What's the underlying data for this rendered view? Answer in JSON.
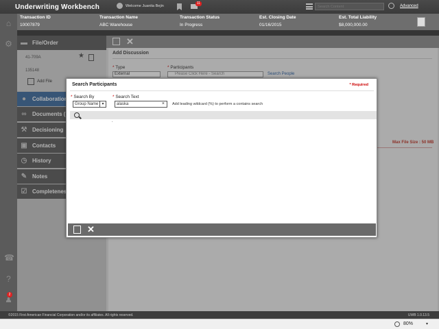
{
  "app": {
    "title": "Underwriting Workbench",
    "welcome": "Welcome Juanita Bejin",
    "mail_count": "11",
    "search_placeholder": "Search Content",
    "advanced_label": "Advanced",
    "notification_count": "2"
  },
  "transaction": {
    "columns": [
      {
        "header": "Transaction ID",
        "value": "10007879"
      },
      {
        "header": "Transaction Name",
        "value": "ABC Warehouse"
      },
      {
        "header": "Transaction Status",
        "value": "In Progress"
      },
      {
        "header": "Est. Closing Date",
        "value": "01/16/2015"
      },
      {
        "header": "Est. Total Liability",
        "value": "$8,000,000.00"
      }
    ]
  },
  "sidebar": {
    "file_order_label": "File/Order",
    "files": [
      "41-709A",
      "135148"
    ],
    "add_file_label": "Add File",
    "items": [
      {
        "label": "Collaboration",
        "icon": "collaboration-icon"
      },
      {
        "label": "Documents (",
        "icon": "link-icon"
      },
      {
        "label": "Decisioning",
        "icon": "gavel-icon"
      },
      {
        "label": "Contacts",
        "icon": "contacts-icon"
      },
      {
        "label": "History",
        "icon": "clock-icon"
      },
      {
        "label": "Notes",
        "icon": "notes-icon"
      },
      {
        "label": "Completeness",
        "icon": "checklist-icon"
      }
    ]
  },
  "main": {
    "section_title": "Add Discussion",
    "type_label": "Type",
    "type_value": "External",
    "participants_label": "Participants",
    "participants_placeholder": "Please Click Here - Search",
    "search_people_label": "Search People",
    "max_file_size": "Max File Size : 50 MB"
  },
  "modal": {
    "title": "Search Participants",
    "required_label": "* Required",
    "search_by_label": "Search By",
    "search_by_value": "Group Name",
    "search_text_label": "Search Text",
    "search_text_value": "alaska",
    "hint": "Add leading wildcard (%) to perform a contains search",
    "result_text": "."
  },
  "footer": {
    "copyright": "©2015 First American Financial Corporation and/or its affiliates. All rights reserved.",
    "version": "UWB 1.0.13.5"
  },
  "statusbar": {
    "zoom": "80%"
  }
}
